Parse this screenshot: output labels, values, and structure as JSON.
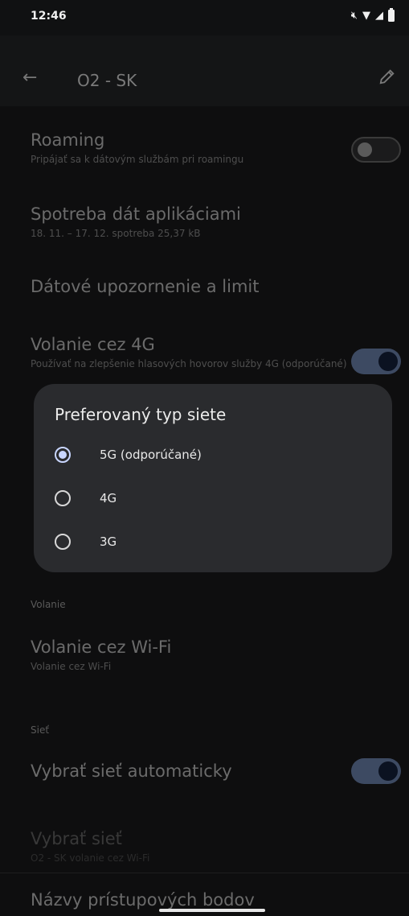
{
  "status_bar": {
    "time": "12:46"
  },
  "app_bar": {
    "title": "O2 - SK"
  },
  "settings": {
    "roaming": {
      "title": "Roaming",
      "subtitle": "Pripájať sa k dátovým službám pri roamingu",
      "enabled": false
    },
    "data_usage": {
      "title": "Spotreba dát aplikáciami",
      "subtitle": "18. 11. – 17. 12. spotreba 25,37 kB"
    },
    "data_warning": {
      "title": "Dátové upozornenie a limit"
    },
    "volte": {
      "title": "Volanie cez 4G",
      "subtitle": "Používať na zlepšenie hlasových hovorov služby 4G (odporúčané)",
      "enabled": true
    },
    "calling_section": "Volanie",
    "wifi_calling": {
      "title": "Volanie cez Wi-Fi",
      "subtitle": "Volanie cez Wi-Fi"
    },
    "network_section": "Sieť",
    "auto_network": {
      "title": "Vybrať sieť automaticky",
      "enabled": true
    },
    "select_network": {
      "title": "Vybrať sieť",
      "subtitle": "O2 - SK volanie cez Wi-Fi"
    },
    "apn": {
      "title": "Názvy prístupových bodov"
    }
  },
  "dialog": {
    "title": "Preferovaný typ siete",
    "options": [
      {
        "label": "5G (odporúčané)",
        "selected": true
      },
      {
        "label": "4G",
        "selected": false
      },
      {
        "label": "3G",
        "selected": false
      }
    ]
  },
  "colors": {
    "accent": "#c9d6ff",
    "toggle_on": "#3d4a62",
    "dialog_bg": "#2a2b2e"
  }
}
